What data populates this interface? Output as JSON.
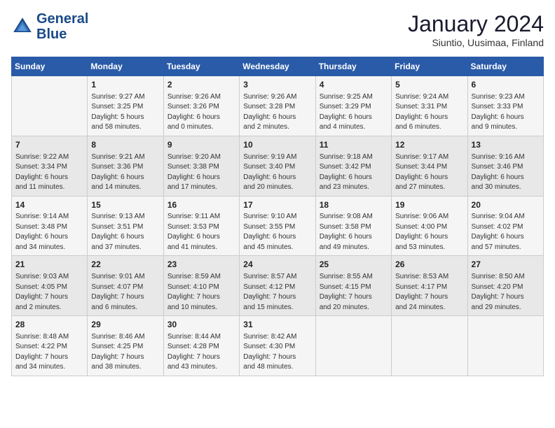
{
  "header": {
    "logo_line1": "General",
    "logo_line2": "Blue",
    "month_year": "January 2024",
    "location": "Siuntio, Uusimaa, Finland"
  },
  "days_of_week": [
    "Sunday",
    "Monday",
    "Tuesday",
    "Wednesday",
    "Thursday",
    "Friday",
    "Saturday"
  ],
  "weeks": [
    [
      {
        "day": "",
        "info": ""
      },
      {
        "day": "1",
        "info": "Sunrise: 9:27 AM\nSunset: 3:25 PM\nDaylight: 5 hours\nand 58 minutes."
      },
      {
        "day": "2",
        "info": "Sunrise: 9:26 AM\nSunset: 3:26 PM\nDaylight: 6 hours\nand 0 minutes."
      },
      {
        "day": "3",
        "info": "Sunrise: 9:26 AM\nSunset: 3:28 PM\nDaylight: 6 hours\nand 2 minutes."
      },
      {
        "day": "4",
        "info": "Sunrise: 9:25 AM\nSunset: 3:29 PM\nDaylight: 6 hours\nand 4 minutes."
      },
      {
        "day": "5",
        "info": "Sunrise: 9:24 AM\nSunset: 3:31 PM\nDaylight: 6 hours\nand 6 minutes."
      },
      {
        "day": "6",
        "info": "Sunrise: 9:23 AM\nSunset: 3:33 PM\nDaylight: 6 hours\nand 9 minutes."
      }
    ],
    [
      {
        "day": "7",
        "info": "Sunrise: 9:22 AM\nSunset: 3:34 PM\nDaylight: 6 hours\nand 11 minutes."
      },
      {
        "day": "8",
        "info": "Sunrise: 9:21 AM\nSunset: 3:36 PM\nDaylight: 6 hours\nand 14 minutes."
      },
      {
        "day": "9",
        "info": "Sunrise: 9:20 AM\nSunset: 3:38 PM\nDaylight: 6 hours\nand 17 minutes."
      },
      {
        "day": "10",
        "info": "Sunrise: 9:19 AM\nSunset: 3:40 PM\nDaylight: 6 hours\nand 20 minutes."
      },
      {
        "day": "11",
        "info": "Sunrise: 9:18 AM\nSunset: 3:42 PM\nDaylight: 6 hours\nand 23 minutes."
      },
      {
        "day": "12",
        "info": "Sunrise: 9:17 AM\nSunset: 3:44 PM\nDaylight: 6 hours\nand 27 minutes."
      },
      {
        "day": "13",
        "info": "Sunrise: 9:16 AM\nSunset: 3:46 PM\nDaylight: 6 hours\nand 30 minutes."
      }
    ],
    [
      {
        "day": "14",
        "info": "Sunrise: 9:14 AM\nSunset: 3:48 PM\nDaylight: 6 hours\nand 34 minutes."
      },
      {
        "day": "15",
        "info": "Sunrise: 9:13 AM\nSunset: 3:51 PM\nDaylight: 6 hours\nand 37 minutes."
      },
      {
        "day": "16",
        "info": "Sunrise: 9:11 AM\nSunset: 3:53 PM\nDaylight: 6 hours\nand 41 minutes."
      },
      {
        "day": "17",
        "info": "Sunrise: 9:10 AM\nSunset: 3:55 PM\nDaylight: 6 hours\nand 45 minutes."
      },
      {
        "day": "18",
        "info": "Sunrise: 9:08 AM\nSunset: 3:58 PM\nDaylight: 6 hours\nand 49 minutes."
      },
      {
        "day": "19",
        "info": "Sunrise: 9:06 AM\nSunset: 4:00 PM\nDaylight: 6 hours\nand 53 minutes."
      },
      {
        "day": "20",
        "info": "Sunrise: 9:04 AM\nSunset: 4:02 PM\nDaylight: 6 hours\nand 57 minutes."
      }
    ],
    [
      {
        "day": "21",
        "info": "Sunrise: 9:03 AM\nSunset: 4:05 PM\nDaylight: 7 hours\nand 2 minutes."
      },
      {
        "day": "22",
        "info": "Sunrise: 9:01 AM\nSunset: 4:07 PM\nDaylight: 7 hours\nand 6 minutes."
      },
      {
        "day": "23",
        "info": "Sunrise: 8:59 AM\nSunset: 4:10 PM\nDaylight: 7 hours\nand 10 minutes."
      },
      {
        "day": "24",
        "info": "Sunrise: 8:57 AM\nSunset: 4:12 PM\nDaylight: 7 hours\nand 15 minutes."
      },
      {
        "day": "25",
        "info": "Sunrise: 8:55 AM\nSunset: 4:15 PM\nDaylight: 7 hours\nand 20 minutes."
      },
      {
        "day": "26",
        "info": "Sunrise: 8:53 AM\nSunset: 4:17 PM\nDaylight: 7 hours\nand 24 minutes."
      },
      {
        "day": "27",
        "info": "Sunrise: 8:50 AM\nSunset: 4:20 PM\nDaylight: 7 hours\nand 29 minutes."
      }
    ],
    [
      {
        "day": "28",
        "info": "Sunrise: 8:48 AM\nSunset: 4:22 PM\nDaylight: 7 hours\nand 34 minutes."
      },
      {
        "day": "29",
        "info": "Sunrise: 8:46 AM\nSunset: 4:25 PM\nDaylight: 7 hours\nand 38 minutes."
      },
      {
        "day": "30",
        "info": "Sunrise: 8:44 AM\nSunset: 4:28 PM\nDaylight: 7 hours\nand 43 minutes."
      },
      {
        "day": "31",
        "info": "Sunrise: 8:42 AM\nSunset: 4:30 PM\nDaylight: 7 hours\nand 48 minutes."
      },
      {
        "day": "",
        "info": ""
      },
      {
        "day": "",
        "info": ""
      },
      {
        "day": "",
        "info": ""
      }
    ]
  ]
}
